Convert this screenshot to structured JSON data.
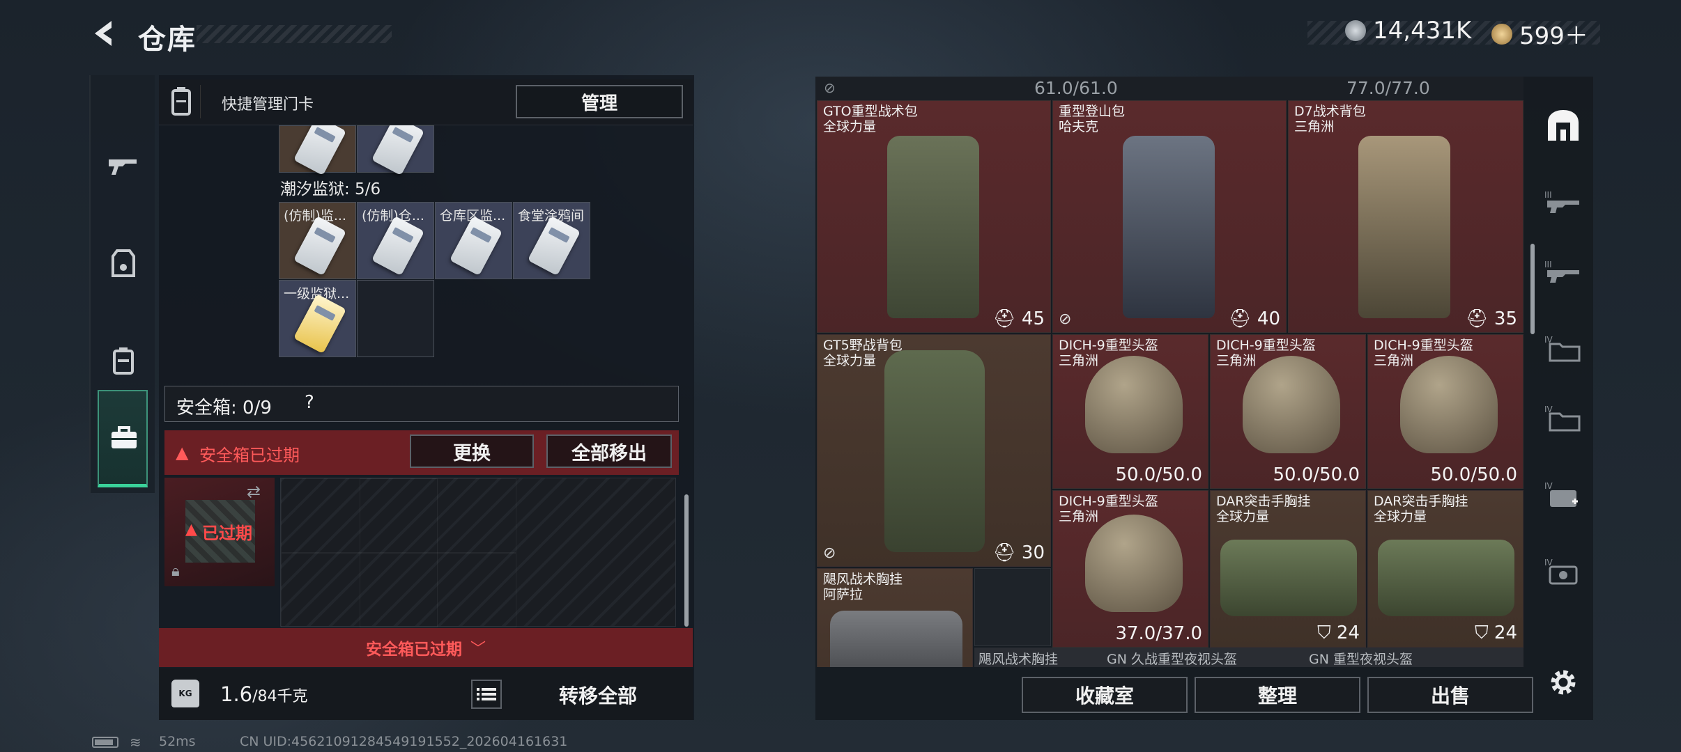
{
  "header": {
    "title": "仓库",
    "currency1": "14,431K",
    "currency2": "599＋"
  },
  "left": {
    "quick_label": "快捷管理门卡",
    "manage_button": "管理",
    "prison_label": "潮汐监狱: 5/6",
    "cards": [
      "(仿制)监...",
      "(仿制)仓...",
      "仓库区监...",
      "食堂涂鸦间",
      "一级监狱..."
    ],
    "safe_label": "安全箱: 0/9",
    "safe_help": "?",
    "expired_label": "安全箱已过期",
    "swap_button": "更换",
    "move_out_button": "全部移出",
    "expired_badge": "已过期",
    "expired_footer": "安全箱已过期",
    "weight_value": "1.6",
    "weight_max": "/84千克",
    "transfer_button": "转移全部"
  },
  "right": {
    "header_left": "61.0/61.0",
    "header_right": "77.0/77.0",
    "items": [
      {
        "name": "GTO重型战术包",
        "sub": "全球力量",
        "value": "45"
      },
      {
        "name": "重型登山包",
        "sub": "哈夫克",
        "value": "40"
      },
      {
        "name": "D7战术背包",
        "sub": "三角洲",
        "value": "35"
      },
      {
        "name": "GT5野战背包",
        "sub": "全球力量",
        "value": "30"
      },
      {
        "name": "DICH-9重型头盔",
        "sub": "三角洲",
        "value": "50.0/50.0"
      },
      {
        "name": "DICH-9重型头盔",
        "sub": "三角洲",
        "value": "50.0/50.0"
      },
      {
        "name": "DICH-9重型头盔",
        "sub": "三角洲",
        "value": "50.0/50.0"
      },
      {
        "name": "DICH-9重型头盔",
        "sub": "三角洲",
        "value": "37.0/37.0"
      },
      {
        "name": "DAR突击手胸挂",
        "sub": "全球力量",
        "value": "24"
      },
      {
        "name": "DAR突击手胸挂",
        "sub": "全球力量",
        "value": "24"
      },
      {
        "name": "飓风战术胸挂",
        "sub": "阿萨拉",
        "value": ""
      }
    ],
    "bottom_labels": [
      "飓风战术胸挂",
      "GN 久战重型夜视头盔",
      "GN 重型夜视头盔"
    ],
    "collection_button": "收藏室",
    "sort_button": "整理",
    "sell_button": "出售"
  },
  "footer": {
    "ping": "52ms",
    "uid": "CN UID:45621091284549191552_202604161631"
  },
  "colors": {
    "expired_red": "#d83a3a",
    "accent_green": "#3ad29a",
    "item_red": "#5a2a2c",
    "item_brown": "#4c3a30"
  }
}
